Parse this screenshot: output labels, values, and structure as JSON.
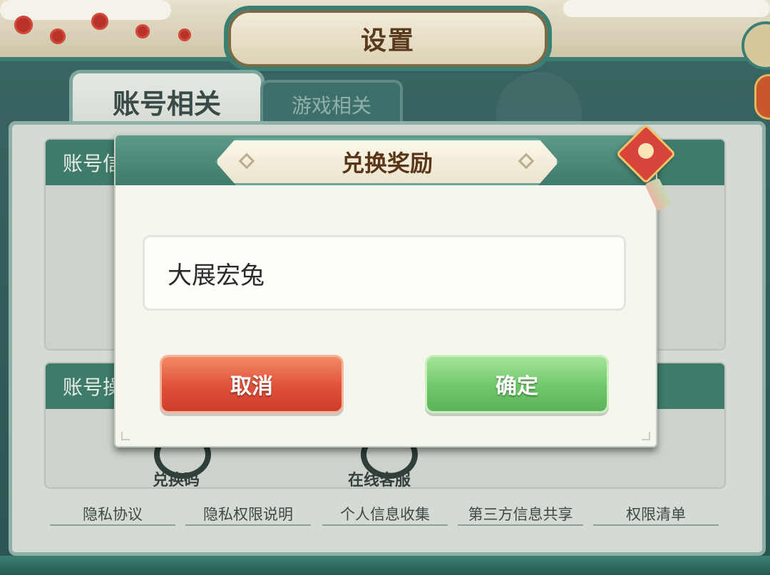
{
  "screen": {
    "title": "设置"
  },
  "tabs": [
    {
      "label": "账号相关",
      "active": true
    },
    {
      "label": "游戏相关",
      "active": false
    }
  ],
  "sections": [
    {
      "label": "账号信息"
    },
    {
      "label": "账号操作"
    }
  ],
  "shortcuts": [
    {
      "label": "兑换码",
      "icon": "redeem-code-icon"
    },
    {
      "label": "在线客服",
      "icon": "customer-service-icon"
    }
  ],
  "footer_links": [
    "隐私协议",
    "隐私权限说明",
    "个人信息收集",
    "第三方信息共享",
    "权限清单"
  ],
  "dialog": {
    "title": "兑换奖励",
    "input_value": "大展宏兔",
    "cancel_label": "取消",
    "confirm_label": "确定"
  },
  "colors": {
    "accent_teal": "#3f7a6b",
    "cancel_red": "#e0503a",
    "confirm_green": "#6fc76a",
    "title_brown": "#5b3518"
  }
}
